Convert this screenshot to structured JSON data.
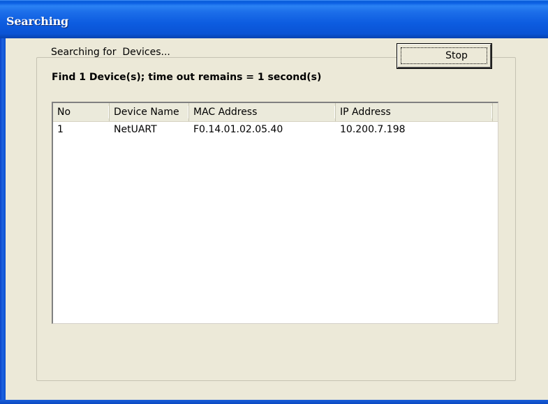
{
  "window": {
    "title": "Searching"
  },
  "status": {
    "searching_text": "Searching for  Devices...",
    "find_text": "Find 1 Device(s); time out remains = 1 second(s)"
  },
  "buttons": {
    "stop_label": "Stop"
  },
  "device_list": {
    "columns": [
      "No",
      "Device Name",
      "MAC Address",
      "IP Address"
    ],
    "rows": [
      [
        "1",
        "NetUART",
        "F0.14.01.02.05.40",
        "10.200.7.198"
      ]
    ]
  },
  "colors": {
    "titlebar": "#0a53d4",
    "dialog_bg": "#ece9d8",
    "list_bg": "#ffffff"
  }
}
